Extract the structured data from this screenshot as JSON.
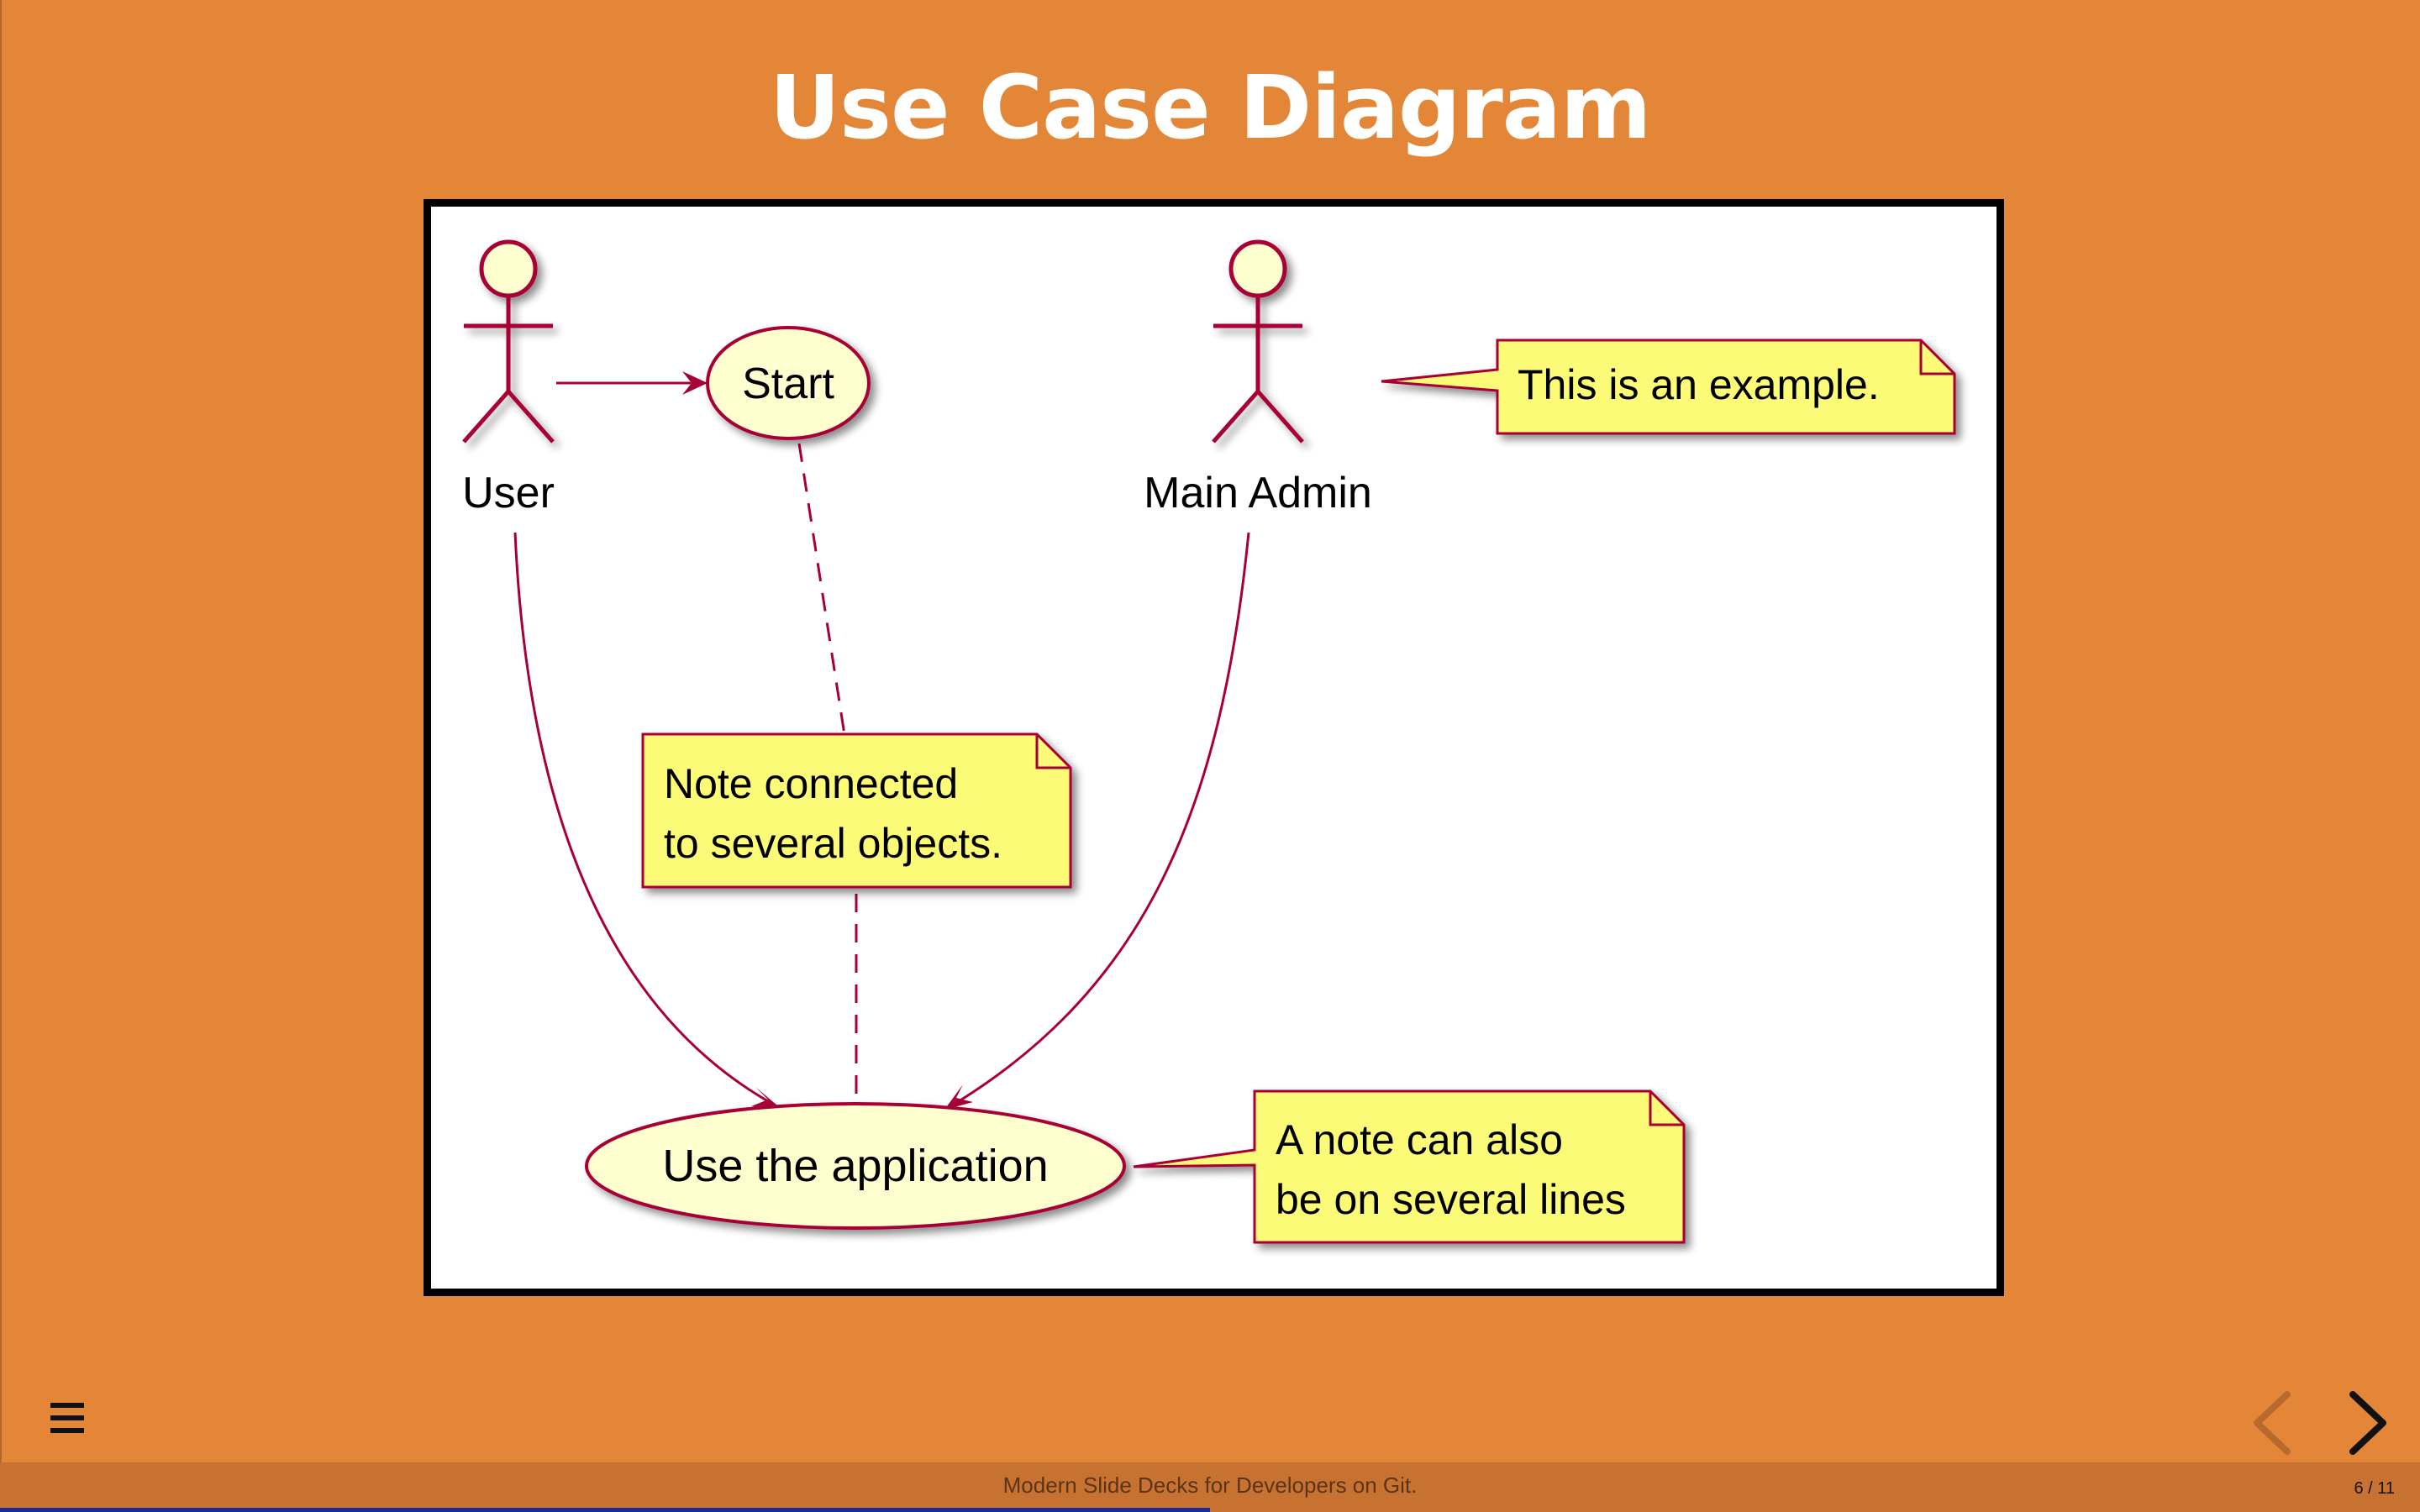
{
  "slide": {
    "title": "Use Case Diagram",
    "background_color": "#e38637"
  },
  "diagram": {
    "actors": [
      {
        "label": "User"
      },
      {
        "label": "Main Admin"
      }
    ],
    "use_cases": [
      {
        "label": "Start"
      },
      {
        "label": "Use the application"
      }
    ],
    "notes": [
      {
        "lines": [
          "This is an example."
        ]
      },
      {
        "lines": [
          "Note connected",
          "to several objects."
        ]
      },
      {
        "lines": [
          "A note can also",
          "be on several lines"
        ]
      }
    ],
    "colors": {
      "stroke": "#a80036",
      "actor_fill": "#fefece",
      "note_fill": "#fbfb77"
    }
  },
  "footer": {
    "text": "Modern Slide Decks for Developers on Git.",
    "slide_counter": "6 / 11",
    "current_slide": 6,
    "total_slides": 11,
    "progress_fraction": 0.5
  },
  "icons": {
    "menu": "hamburger-menu-icon",
    "prev": "chevron-left-icon",
    "next": "chevron-right-icon"
  },
  "theme": {
    "progress_color": "#1a2a9a",
    "nav_disabled_color": "#b86a2e",
    "nav_enabled_color": "#111111"
  }
}
